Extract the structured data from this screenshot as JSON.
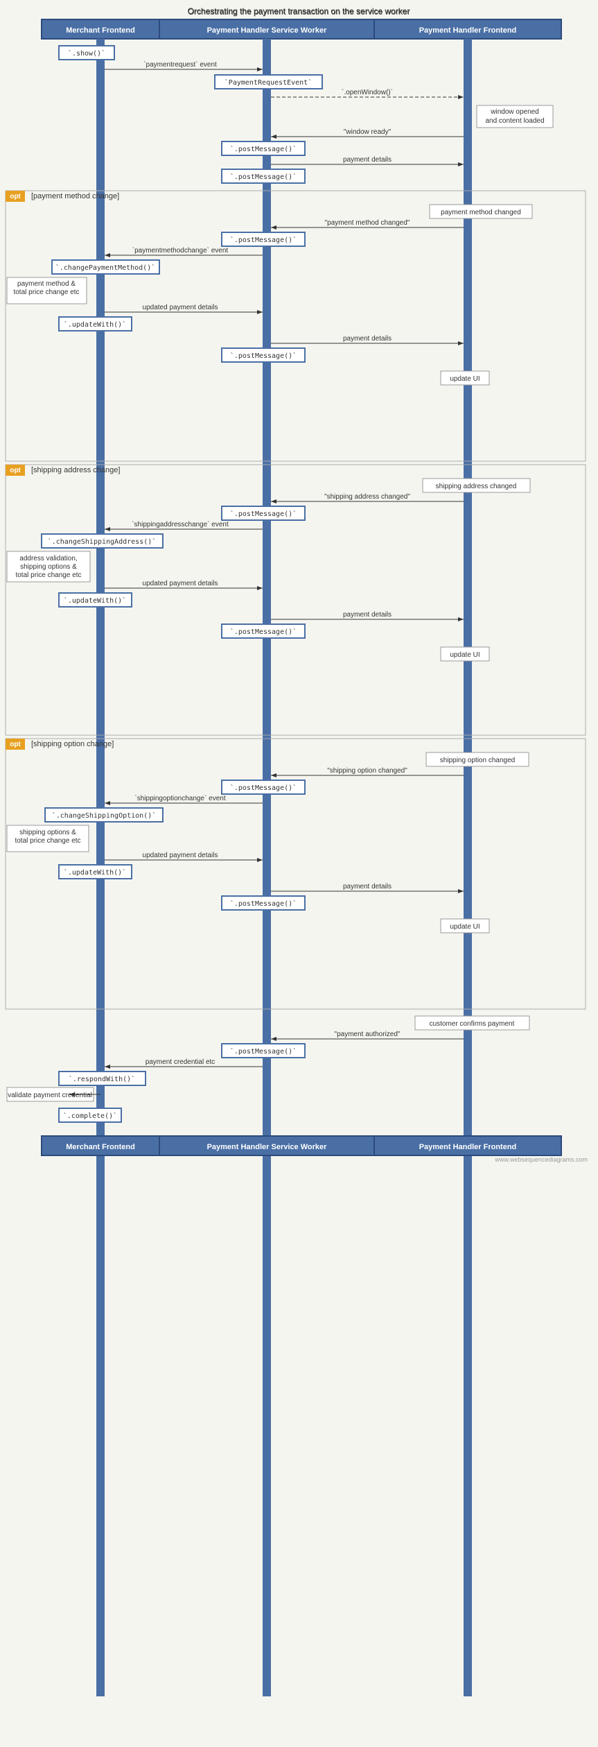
{
  "title": "Orchestrating the payment transaction on the service worker",
  "lifelines": {
    "merchant": "Merchant Frontend",
    "serviceworker": "Payment Handler Service Worker",
    "frontend": "Payment Handler Frontend"
  },
  "watermark": "www.websequencediagrams.com",
  "sections": {
    "opt1": "[payment method change]",
    "opt2": "[shipping address change]",
    "opt3": "[shipping option change]"
  }
}
